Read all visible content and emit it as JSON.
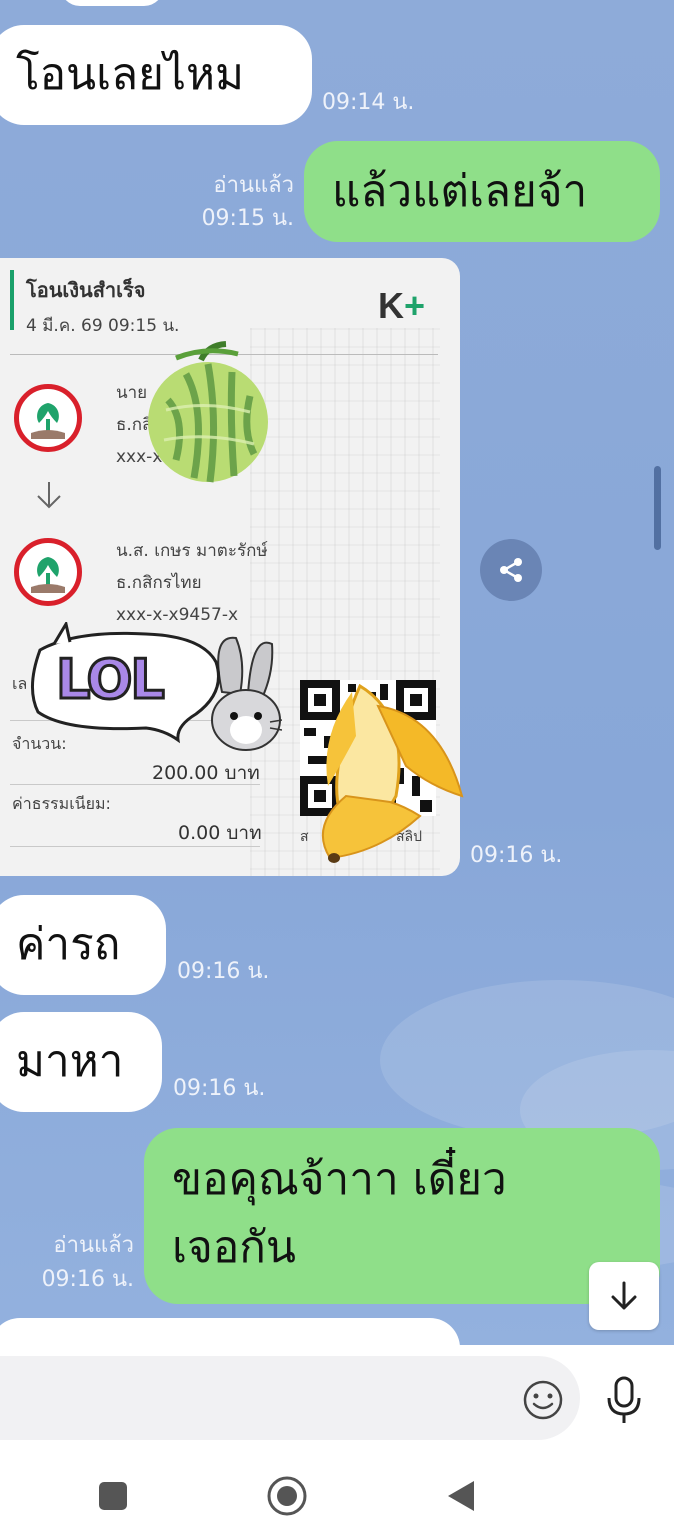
{
  "messages": [
    {
      "id": "m1",
      "direction": "in",
      "text": "โอนเลยไหม",
      "time": "09:14 น."
    },
    {
      "id": "m2",
      "direction": "out",
      "text": "แล้วแต่เลยจ้า",
      "read": "อ่านแล้ว",
      "time": "09:15 น."
    },
    {
      "id": "m3",
      "direction": "in",
      "type": "image",
      "time": "09:16 น."
    },
    {
      "id": "m4",
      "direction": "in",
      "text": "ค่ารถ",
      "time": "09:16 น."
    },
    {
      "id": "m5",
      "direction": "in",
      "text": "มาหา",
      "time": "09:16 น."
    },
    {
      "id": "m6",
      "direction": "out",
      "text_line1": "ขอคุณจ้าาา เดี๋ยว",
      "text_line2": "เจอกัน",
      "read": "อ่านแล้ว",
      "time": "09:16 น."
    }
  ],
  "slip": {
    "title": "โอนเงินสำเร็จ",
    "date": "4 มี.ค. 69  09:15 น.",
    "brand_k": "K",
    "brand_plus": "+",
    "sender_name": "นาย",
    "sender_bank": "ธ.กสิ",
    "sender_account": "xxx-x",
    "receiver_name": "น.ส. เกษร มาตะรักษ์",
    "receiver_bank": "ธ.กสิกรไทย",
    "receiver_account": "xxx-x-x9457-x",
    "ref_label_partial": "เล",
    "amount_label": "จำนวน:",
    "amount_value": "200.00 บาท",
    "fee_label": "ค่าธรรมเนียม:",
    "fee_value": "0.00 บาท",
    "qr_caption_a": "ส",
    "qr_caption_b": "สลิป",
    "stickers": [
      "melon-sticker",
      "lol-rabbit-sticker",
      "banana-sticker"
    ],
    "lol_text": "LOL"
  },
  "input": {
    "placeholder": ""
  },
  "colors": {
    "outgoing": "#8fdf89",
    "incoming": "#ffffff",
    "background": "#8aa9d8",
    "kbank_red": "#d9202b",
    "kbank_green": "#1fa36b"
  },
  "icons": {
    "share": "share-icon",
    "scroll_down": "arrow-down-icon",
    "emoji": "emoji-icon",
    "mic": "mic-icon",
    "nav_recent": "square-icon",
    "nav_home": "circle-icon",
    "nav_back": "triangle-back-icon"
  }
}
